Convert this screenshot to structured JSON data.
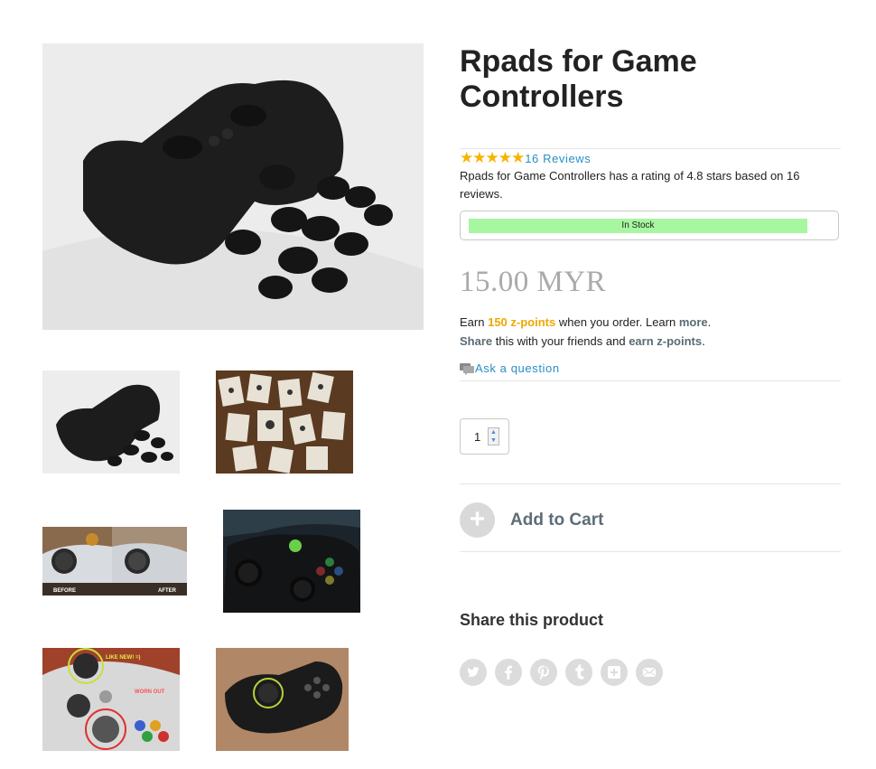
{
  "product": {
    "title": "Rpads for Game Controllers",
    "rating_stars": "★★★★★",
    "reviews_link": "16 Reviews",
    "rating_text": "Rpads for Game Controllers has a rating of 4.8 stars based on 16 reviews.",
    "rating_value": 4.8,
    "stock_status": "In Stock",
    "price": "15.00 MYR"
  },
  "points": {
    "earn_prefix": "Earn",
    "amount": "150 z-points",
    "earn_suffix": "when you order. Learn",
    "learn_more": "more",
    "period": ".",
    "share_link": "Share",
    "share_middle": "this with your friends and",
    "earn_link": "earn z-points",
    "period2": "."
  },
  "ask_question": "Ask a question",
  "quantity": "1",
  "add_to_cart": "Add to Cart",
  "share_section": {
    "title": "Share this product",
    "networks": [
      "twitter-icon",
      "facebook-icon",
      "pinterest-icon",
      "tumblr-icon",
      "google-plus-icon",
      "email-icon"
    ]
  },
  "gallery": {
    "before_label": "BEFORE",
    "after_label": "AFTER",
    "like_new_label": "LIKE NEW! =)",
    "worn_out_label": "WORN OUT"
  },
  "colors": {
    "star": "#f6b400",
    "link": "#2a8ec6",
    "points": "#f0a800",
    "stock_bar": "#a7f7a0",
    "price": "#aaaaaa"
  }
}
